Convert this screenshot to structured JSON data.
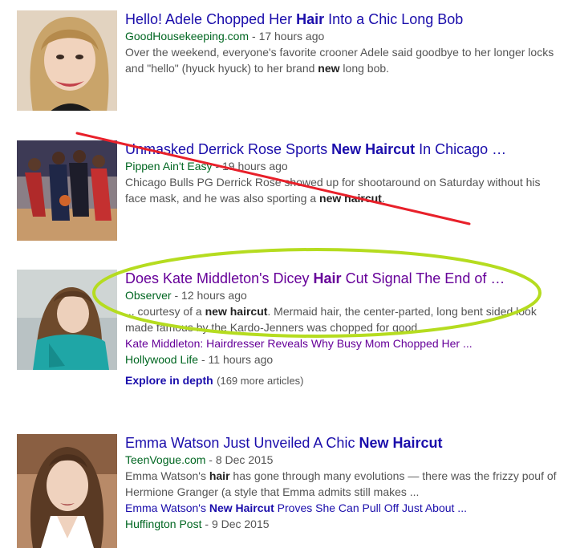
{
  "results": [
    {
      "title_pre": "Hello! Adele Chopped Her ",
      "title_bold": "Hair",
      "title_post": " Into a Chic Long Bob",
      "source": "GoodHousekeeping.com",
      "sep": " - ",
      "time": "17 hours ago",
      "snippet_pre": "Over the weekend, everyone's favorite crooner Adele said goodbye to her longer locks and \"hello\" (hyuck hyuck) to her brand ",
      "snippet_bold": "new",
      "snippet_post": " long bob."
    },
    {
      "title_pre": "Unmasked Derrick Rose Sports ",
      "title_bold": "New Haircut",
      "title_post": " In Chicago …",
      "source": "Pippen Ain't Easy",
      "sep": " - ",
      "time": "19 hours ago",
      "snippet_pre": "Chicago Bulls PG Derrick Rose showed up for shootaround on Saturday without his face mask, and he was also sporting a ",
      "snippet_bold": "new haircut",
      "snippet_post": "."
    },
    {
      "title_pre": "Does Kate Middleton's Dicey ",
      "title_bold": "Hair",
      "title_post": " Cut Signal The End of …",
      "source": "Observer",
      "sep": " - ",
      "time": "12 hours ago",
      "snippet_pre": "... courtesy of a ",
      "snippet_bold": "new haircut",
      "snippet_post": ". Mermaid hair, the center-parted, long bent sided look made famous by the Kardo-Jenners was chopped for good.",
      "sub_title": "Kate Middleton: Hairdresser Reveals Why Busy Mom Chopped Her ...",
      "sub_source": "Hollywood Life",
      "sub_time": "11 hours ago",
      "explore": "Explore in depth",
      "explore_count": "(169 more articles)"
    },
    {
      "title_pre": "Emma Watson Just Unveiled A Chic ",
      "title_bold": "New Haircut",
      "title_post": "",
      "source": "TeenVogue.com",
      "sep": " - ",
      "time": "8 Dec 2015",
      "snippet_pre": "Emma Watson's ",
      "snippet_bold": "hair",
      "snippet_post": " has gone through many evolutions — there was the frizzy pouf of Hermione Granger (a style that Emma admits still makes ...",
      "sub_title_pre": "Emma Watson's ",
      "sub_title_bold": "New Haircut",
      "sub_title_post": " Proves She Can Pull Off Just About ...",
      "sub_source": "Huffington Post",
      "sub_time": "9 Dec 2015"
    }
  ],
  "colors": {
    "link": "#1a0dab",
    "visited": "#660099",
    "source_green": "#006621",
    "snippet_gray": "#545454",
    "strike_red": "#e8202a",
    "circle_green": "#b5dc20"
  }
}
